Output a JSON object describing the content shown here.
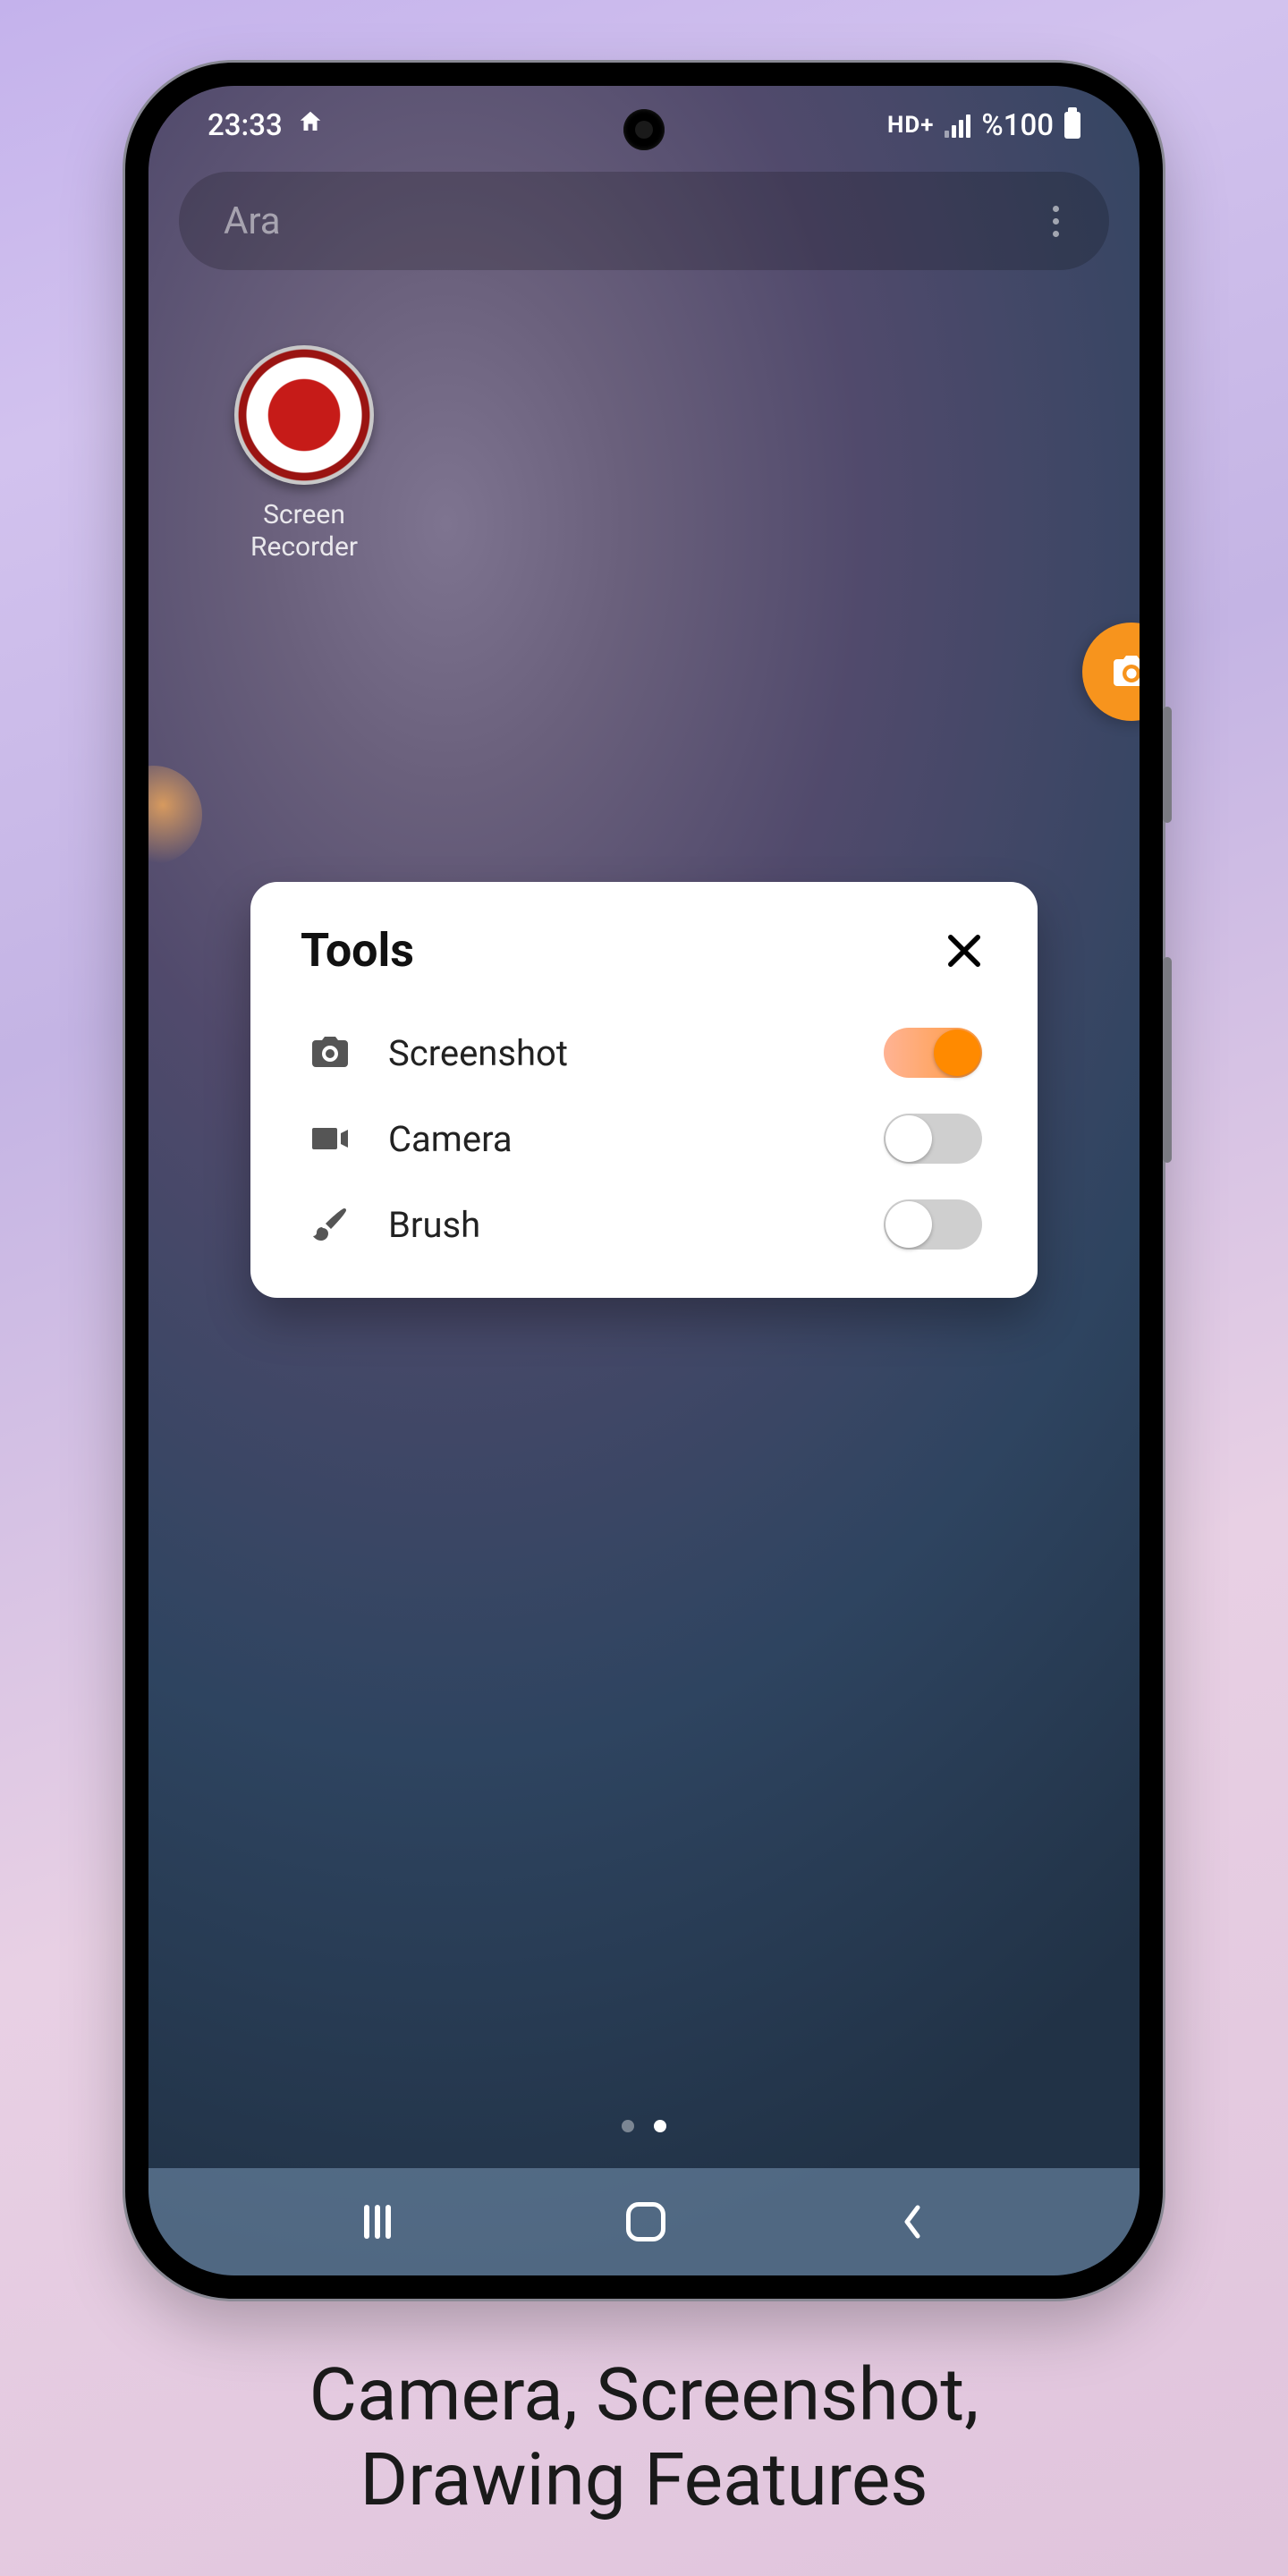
{
  "statusbar": {
    "time": "23:33",
    "net_badge": "HD+",
    "battery_text": "%100"
  },
  "search": {
    "placeholder": "Ara"
  },
  "app": {
    "label_line1": "Screen",
    "label_line2": "Recorder"
  },
  "dialog": {
    "title": "Tools",
    "rows": [
      {
        "icon": "camera-photo-icon",
        "label": "Screenshot",
        "on": true
      },
      {
        "icon": "video-camera-icon",
        "label": "Camera",
        "on": false
      },
      {
        "icon": "brush-icon",
        "label": "Brush",
        "on": false
      }
    ]
  },
  "caption": {
    "line1": "Camera, Screenshot,",
    "line2": "Drawing Features"
  }
}
